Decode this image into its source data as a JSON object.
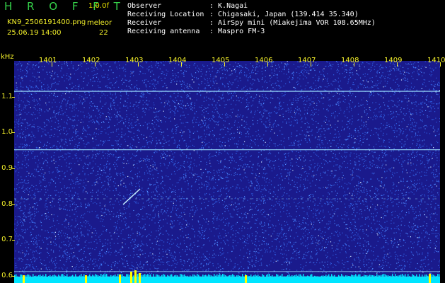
{
  "header": {
    "logo": "H R O F F T",
    "version": "1.0.0f",
    "filename": "KN9_2506191400.png",
    "timestamp": "25.06.19 14:00",
    "meteor_label": "meleor",
    "meteor_count": "22",
    "observer_label": "Observer",
    "observer_value": ": K.Nagai",
    "location_label": "Receiving Location",
    "location_value": ": Chigasaki, Japan (139.414 35.340)",
    "receiver_label": "Receiver",
    "receiver_value": ": AirSpy mini (Miakejima VOR 108.65MHz)",
    "antenna_label": "Receiving antenna",
    "antenna_value": ": Maspro FM-3"
  },
  "chart_data": {
    "type": "heatmap",
    "ylabel": "kHz",
    "x_ticks": [
      "1401",
      "1402",
      "1403",
      "1404",
      "1405",
      "1406",
      "1407",
      "1408",
      "1409",
      "1410"
    ],
    "y_ticks": [
      "1.1",
      "1.0",
      "0.9",
      "0.8",
      "0.7",
      "0.6"
    ],
    "ylim": [
      0.58,
      1.2
    ],
    "horizontal_lines_khz": [
      1.115,
      0.952,
      0.815,
      0.612,
      0.597
    ],
    "colors": {
      "background": "#1a1a8c",
      "noise": "#3a7cff",
      "signal_line": "#9fe3ff",
      "carrier": "#00e5ff",
      "burst": "#ffff00"
    }
  }
}
